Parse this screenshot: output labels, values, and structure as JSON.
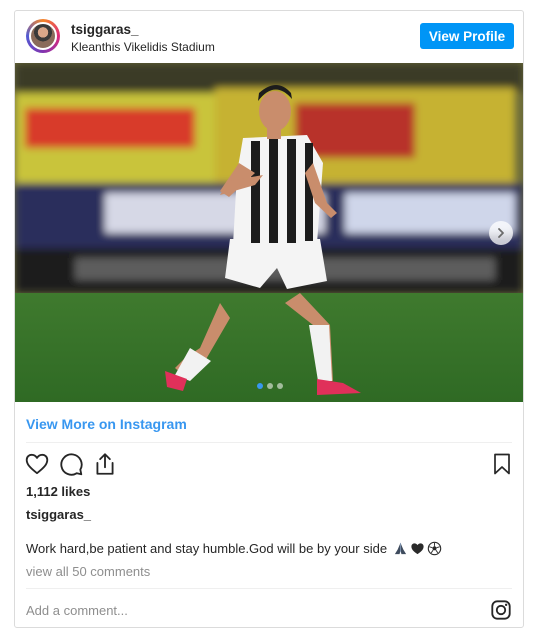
{
  "post": {
    "username": "tsiggaras_",
    "location": "Kleanthis Vikelidis Stadium",
    "view_profile_label": "View Profile",
    "view_more_label": "View More on Instagram",
    "likes": "1,112 likes",
    "caption_user": "tsiggaras_",
    "caption_text": "Work hard,be patient and stay humble.God will be by your side",
    "view_comments_label": "view all 50 comments",
    "add_comment_placeholder": "Add a comment...",
    "carousel_dots": 3,
    "carousel_active_index": 0
  },
  "icons": {
    "like": "heart-icon",
    "comment": "comment-icon",
    "share": "share-icon",
    "save": "bookmark-icon",
    "next": "chevron-right-icon",
    "brand": "instagram-icon",
    "caption_emojis": [
      "folded-hands-icon",
      "black-heart-icon",
      "soccer-ball-icon"
    ]
  },
  "colors": {
    "accent": "#0095f6",
    "link": "#3897f0",
    "muted": "#8e8e8e",
    "border": "#dbdbdb"
  }
}
